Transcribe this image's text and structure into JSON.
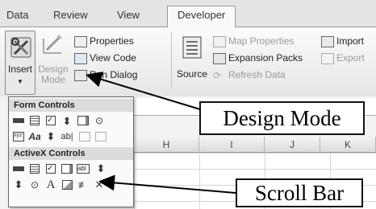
{
  "tabs": [
    "Data",
    "Review",
    "View",
    "Developer"
  ],
  "ribbon": {
    "insert_label": "Insert",
    "design_mode_label_1": "Design",
    "design_mode_label_2": "Mode",
    "properties": "Properties",
    "view_code": "View Code",
    "run_dialog": "Run Dialog",
    "source": "Source",
    "map_properties": "Map Properties",
    "expansion_packs": "Expansion Packs",
    "refresh_data": "Refresh Data",
    "import": "Import",
    "export": "Export"
  },
  "dropdown": {
    "form_controls": "Form Controls",
    "activex_controls": "ActiveX Controls"
  },
  "sheet": {
    "columns": [
      "H",
      "I",
      "J",
      "K"
    ]
  },
  "callouts": {
    "design_mode": "Design Mode",
    "scroll_bar": "Scroll Bar"
  }
}
